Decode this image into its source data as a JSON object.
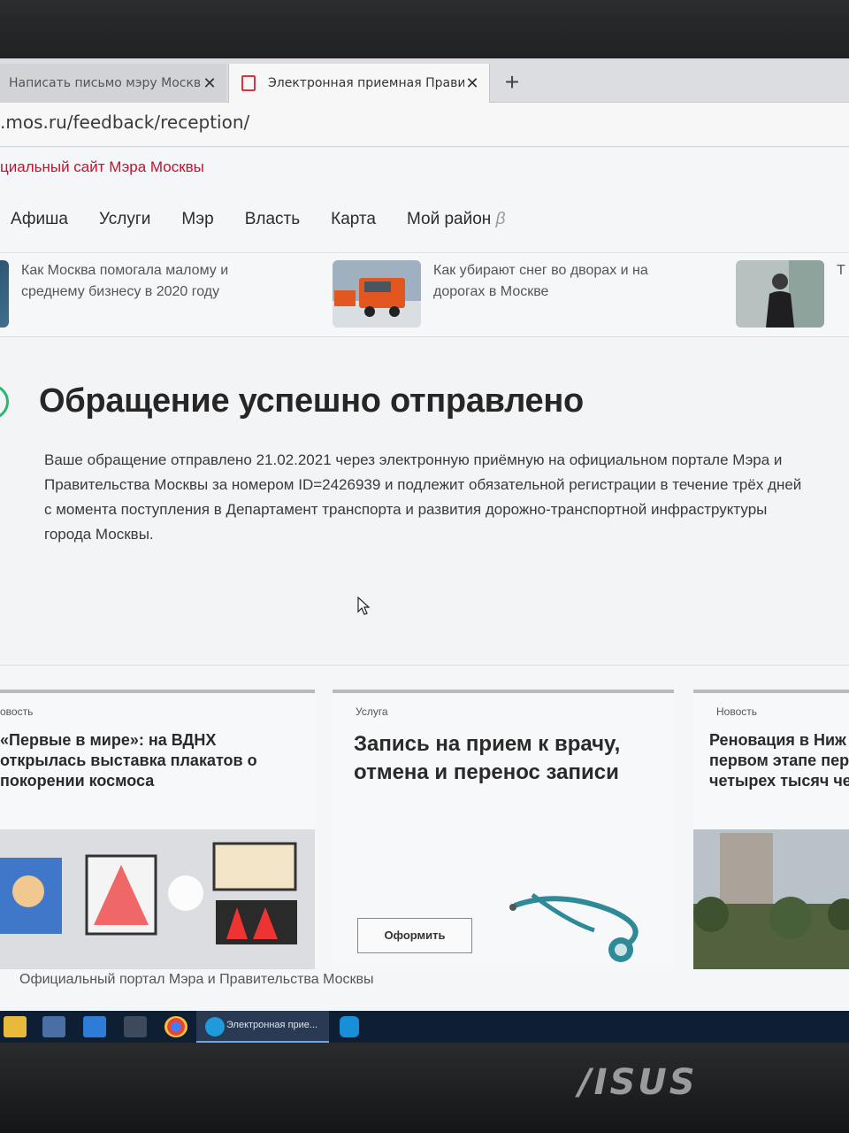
{
  "browser": {
    "tabs": [
      {
        "label": "Написать письмо мэру Москвы"
      },
      {
        "label": "Электронная приемная Правит"
      }
    ],
    "new_tab": "+",
    "close": "✕",
    "url": ".mos.ru/feedback/reception/"
  },
  "site": {
    "title": "циальный сайт Мэра Москвы",
    "nav": [
      "Афиша",
      "Услуги",
      "Мэр",
      "Власть",
      "Карта",
      "Мой район"
    ],
    "nav_beta": "β",
    "teasers": [
      {
        "text": "Как Москва помогала малому и среднему бизнесу в 2020 году"
      },
      {
        "text": "Как убирают снег во дворах и на дорогах в Москве"
      },
      {
        "text": "Т ра"
      }
    ]
  },
  "success": {
    "heading": "Обращение успешно отправлено",
    "body": "Ваше обращение отправлено 21.02.2021 через электронную приёмную на официальном портале Мэра и Правительства Москвы за номером ID=2426939 и подлежит обязательной регистрации в течение трёх дней с момента поступления в Департамент транспорта и развития дорожно-транспортной инфраструктуры города Москвы."
  },
  "cards": [
    {
      "kind": "овость",
      "title": "«Первые в мире»: на ВДНХ открылась выставка плакатов о покорении космоса"
    },
    {
      "kind": "Услуга",
      "title": "Запись на прием к врачу, отмена и перенос записи",
      "button": "Оформить"
    },
    {
      "kind": "Новость",
      "title": "Реновация в Ниж первом этапе пер четырех тысяч че"
    }
  ],
  "footer": "Официальный портал Мэра и Правительства Москвы",
  "taskbar": {
    "active_window": "Электронная прие..."
  },
  "device": {
    "brand": "/ISUS"
  }
}
